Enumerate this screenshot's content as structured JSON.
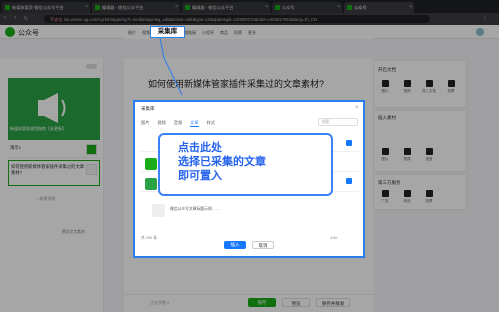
{
  "browser": {
    "tabs": [
      {
        "label": "新媒体管家-微信公众号平台"
      },
      {
        "label": "编辑器 - 微信公众平台"
      },
      {
        "label": "编辑器 - 微信公众平台"
      },
      {
        "label": "公众号"
      },
      {
        "label": "公众号"
      }
    ],
    "security": "不安全",
    "url": "mp.weixin.qq.com/cgi-bin/appmsg?t=media/appmsg_edit&action=edit&type=10&appmsgid=100000272&token=804517953&lang=zh_CN"
  },
  "header": {
    "brand": "公众号"
  },
  "toolbar": {
    "items": [
      "图片",
      "视频",
      "音频",
      "搜索",
      "超链接",
      "小程序",
      "商品",
      "投票",
      "更多"
    ],
    "caiji_label": "采集库"
  },
  "left": {
    "card_title": "新媒体管家使用指南【长更新】",
    "items": [
      "演示1",
      "如何使用新媒体管家插件采集过的文章素材?"
    ],
    "add_label": "+ 新建消息",
    "more_label": "图文文字素材"
  },
  "editor": {
    "title": "如何使用新媒体管家插件采集过的文章素材?",
    "word_count": "正文字数 0"
  },
  "right": {
    "panel1_title": "开启文档",
    "panel1_items": [
      "图片",
      "视频",
      "导入文档",
      "投票"
    ],
    "panel2_title": "插入素材",
    "panel2_items": [
      "图片",
      "视频",
      "语音",
      "卡片"
    ],
    "panel3_title": "第三方服务",
    "panel3_items": [
      "广告",
      "商品",
      "投票"
    ]
  },
  "modal": {
    "title": "采集库",
    "tabs": [
      "图片",
      "视频",
      "音频",
      "文章",
      "样式"
    ],
    "search_placeholder": "搜索",
    "row_texts": [
      "",
      "",
      "",
      "微信公众号文章标题示例……"
    ],
    "footer_total": "共 200 条",
    "page": "1/10",
    "confirm": "插入",
    "cancel": "取消"
  },
  "tip": {
    "lines": [
      "点击此处",
      "选择已采集的文章",
      "即可置入"
    ]
  },
  "bottom": {
    "save": "保存",
    "preview": "预览",
    "publish": "保存并群发"
  }
}
